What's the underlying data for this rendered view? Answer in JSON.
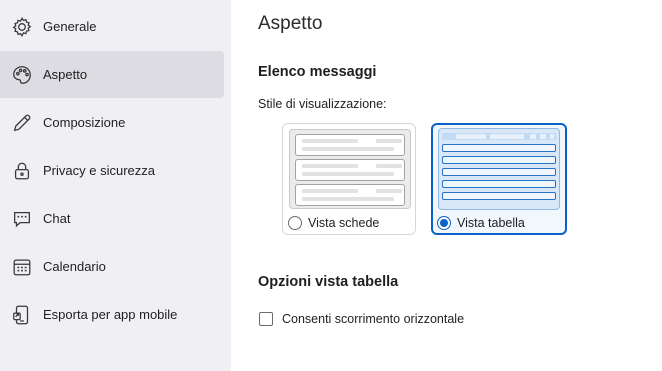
{
  "sidebar": {
    "items": [
      {
        "label": "Generale",
        "icon": "gear-icon",
        "active": false
      },
      {
        "label": "Aspetto",
        "icon": "palette-icon",
        "active": true
      },
      {
        "label": "Composizione",
        "icon": "pencil-icon",
        "active": false
      },
      {
        "label": "Privacy e sicurezza",
        "icon": "lock-icon",
        "active": false
      },
      {
        "label": "Chat",
        "icon": "chat-icon",
        "active": false
      },
      {
        "label": "Calendario",
        "icon": "calendar-icon",
        "active": false
      },
      {
        "label": "Esporta per app mobile",
        "icon": "mobile-export-icon",
        "active": false
      }
    ]
  },
  "main": {
    "title": "Aspetto",
    "message_list": {
      "heading": "Elenco messaggi",
      "display_style_label": "Stile di visualizzazione:",
      "options": [
        {
          "label": "Vista schede",
          "selected": false
        },
        {
          "label": "Vista tabella",
          "selected": true
        }
      ]
    },
    "table_options": {
      "heading": "Opzioni vista tabella",
      "horizontal_scroll_label": "Consenti scorrimento orizzontale",
      "horizontal_scroll_checked": false
    }
  },
  "colors": {
    "accent": "#0a62c7",
    "sidebar_bg": "#f0f0f4",
    "sidebar_active": "#dcdce2"
  }
}
